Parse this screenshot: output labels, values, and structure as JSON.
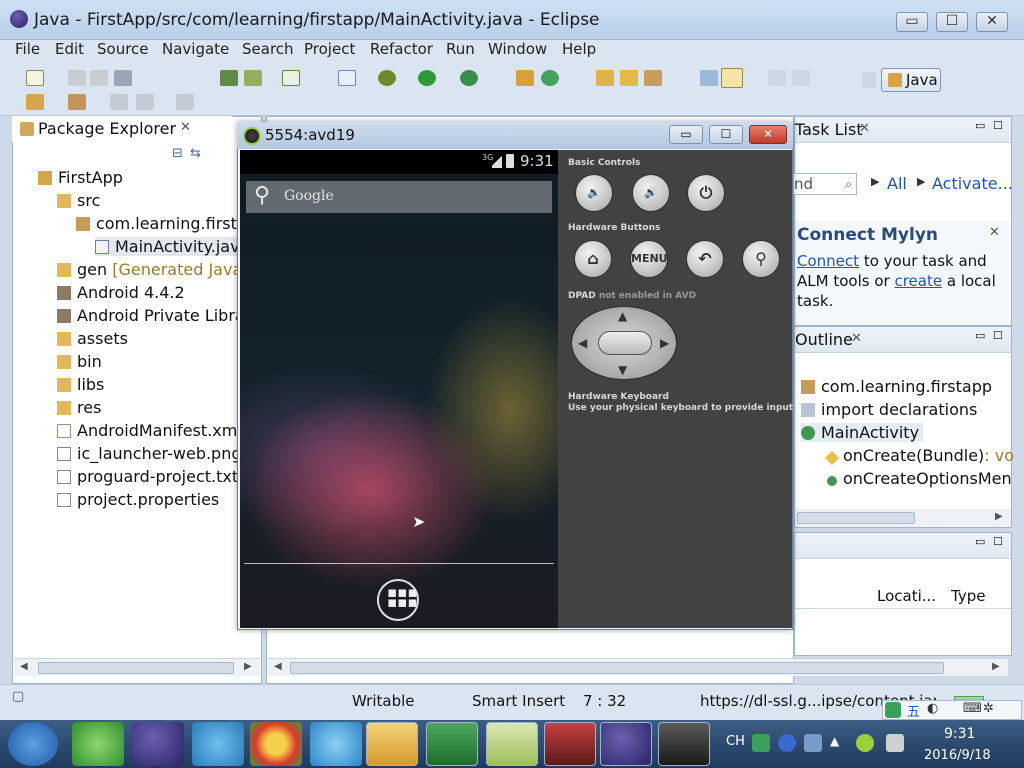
{
  "window": {
    "title": "Java - FirstApp/src/com/learning/firstapp/MainActivity.java - Eclipse",
    "minimize": "▭",
    "restore": "☐",
    "close": "✕"
  },
  "menu": [
    "File",
    "Edit",
    "Source",
    "Navigate",
    "Search",
    "Project",
    "Refactor",
    "Run",
    "Window",
    "Help"
  ],
  "perspective": {
    "label": "Java"
  },
  "package_explorer": {
    "tab_label": "Package Explorer",
    "items": [
      {
        "label": "FirstApp",
        "suffix": ""
      },
      {
        "label": "src",
        "suffix": ""
      },
      {
        "label": "com.learning.firstap",
        "suffix": ""
      },
      {
        "label": "MainActivity.java",
        "suffix": ""
      },
      {
        "label": "gen",
        "suffix": "[Generated Java F"
      },
      {
        "label": "Android 4.4.2",
        "suffix": ""
      },
      {
        "label": "Android Private Librar",
        "suffix": ""
      },
      {
        "label": "assets",
        "suffix": ""
      },
      {
        "label": "bin",
        "suffix": ""
      },
      {
        "label": "libs",
        "suffix": ""
      },
      {
        "label": "res",
        "suffix": ""
      },
      {
        "label": "AndroidManifest.xml",
        "suffix": ""
      },
      {
        "label": "ic_launcher-web.png",
        "suffix": ""
      },
      {
        "label": "proguard-project.txt",
        "suffix": ""
      },
      {
        "label": "project.properties",
        "suffix": ""
      }
    ]
  },
  "task_list": {
    "tab_label": "Task List",
    "find_value": "nd",
    "all_label": "All",
    "activate_label": "Activate..."
  },
  "mylyn": {
    "title": "Connect Mylyn",
    "line1_link": "Connect",
    "line1_rest": "to your task and",
    "line2_start": "ALM tools or",
    "line2_link": "create",
    "line2_rest": "a local",
    "line3": "task."
  },
  "outline": {
    "tab_label": "Outline",
    "items": [
      {
        "label": "com.learning.firstapp",
        "suffix": ""
      },
      {
        "label": "import declarations",
        "suffix": ""
      },
      {
        "label": "MainActivity",
        "suffix": ""
      },
      {
        "label": "onCreate(Bundle)",
        "suffix": ": vo"
      },
      {
        "label": "onCreateOptionsMen",
        "suffix": ""
      }
    ]
  },
  "bottom_table": {
    "headers": [
      "Locati...",
      "Type"
    ]
  },
  "status": {
    "writable": "Writable",
    "insert_mode": "Smart Insert",
    "position": "7 : 32",
    "url": "https://dl-ssl.g...ipse/content.jar"
  },
  "emulator": {
    "title": "5554:avd19",
    "time": "9:31",
    "network": "3G",
    "search_placeholder": "Google",
    "basic_controls": "Basic Controls",
    "hardware_buttons": "Hardware Buttons",
    "dpad_label": "DPAD",
    "dpad_note": "not enabled in AVD",
    "keyboard_title": "Hardware Keyboard",
    "keyboard_note": "Use your physical keyboard to provide input",
    "menu_label": "MENU"
  },
  "taskbar": {
    "ime": "CH",
    "clock_time": "9:31",
    "clock_date": "2016/9/18"
  },
  "colors": {
    "accent": "#1a55b8",
    "android_panel": "#424242",
    "taskbar": "#2a4a72"
  }
}
